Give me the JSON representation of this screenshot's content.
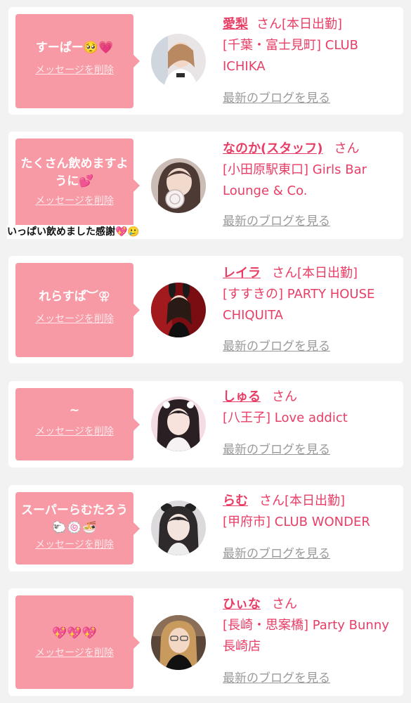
{
  "cards": [
    {
      "bubble_text": "すーぱー🥺💗",
      "delete_label": "メッセージを削除",
      "name": "愛梨",
      "honorific": "さん",
      "status": "[本日出勤]",
      "shop": "[千葉・富士見町] CLUB ICHIKA",
      "blog_link": "最新のブログを見る",
      "avatar_icon": "avatar-photo-icon"
    },
    {
      "bubble_text": "たくさん飲めますように💕",
      "delete_label": "メッセージを削除",
      "name": "なのか(スタッフ)",
      "honorific": "さん",
      "status": "",
      "shop": "[小田原駅東口] Girls Bar Lounge & Co.",
      "blog_link": "最新のブログを見る",
      "avatar_icon": "avatar-photo-icon"
    },
    {
      "bubble_text": "れらすぱ︶⚢",
      "delete_label": "メッセージを削除",
      "name": "レイラ",
      "honorific": "さん",
      "status": "[本日出勤]",
      "shop": "[すすきの] PARTY HOUSE CHIQUITA",
      "blog_link": "最新のブログを見る",
      "avatar_icon": "avatar-photo-icon"
    },
    {
      "bubble_text": "~",
      "delete_label": "メッセージを削除",
      "name": "しゅる",
      "honorific": "さん",
      "status": "",
      "shop": "[八王子] Love addict",
      "blog_link": "最新のブログを見る",
      "avatar_icon": "avatar-photo-icon"
    },
    {
      "bubble_text": "スーパーらむたろう🐑🍥🍜",
      "delete_label": "メッセージを削除",
      "name": "らむ",
      "honorific": "さん",
      "status": "[本日出勤]",
      "shop": "[甲府市] CLUB WONDER",
      "blog_link": "最新のブログを見る",
      "avatar_icon": "avatar-photo-icon"
    },
    {
      "bubble_text": "💖💖💖",
      "delete_label": "メッセージを削除",
      "name": "ひぃな",
      "honorific": "さん",
      "status": "",
      "shop": "[長崎・思案橋] Party Bunny 長崎店",
      "blog_link": "最新のブログを見る",
      "avatar_icon": "avatar-photo-icon"
    }
  ],
  "overlay_note": "いっぱい飲めました感謝💖🥲",
  "colors": {
    "bubble": "#f89aa5",
    "accent": "#e83e66",
    "link_gray": "#9a9a9a",
    "page_bg": "#f2f2f2"
  }
}
